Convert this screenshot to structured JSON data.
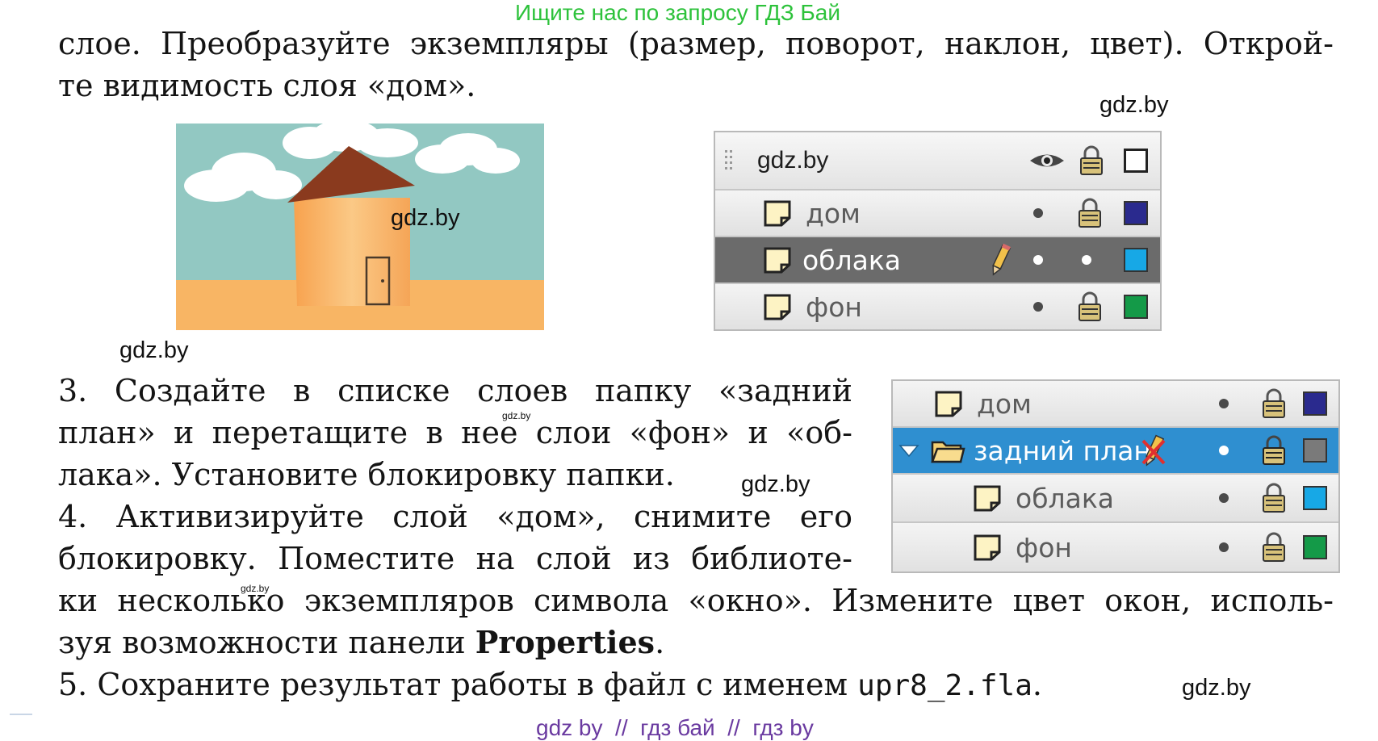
{
  "banner": "Ищите нас по запросу ГДЗ Бай",
  "paragraph_top": {
    "line1": "слое. Преобразуйте экземпляры (размер, поворот, наклон, цвет). Открой-",
    "line2": "те видимость слоя «дом»."
  },
  "step3": {
    "line1": "3. Создайте в списке слоев папку «задний",
    "line2": "план» и перетащите в нее слои «фон» и «об-",
    "line3": "лака». Установите блокировку папки."
  },
  "step4": {
    "line1": "4. Активизируйте слой «дом», снимите его",
    "line2": "блокировку. Поместите на слой из библиоте-",
    "line3": "ки несколько экземпляров символа «окно». Измените цвет окон, исполь-",
    "line4_prefix": "зуя возможности панели ",
    "line4_bold": "Properties",
    "line4_suffix": "."
  },
  "step5": {
    "prefix": "5. Сохраните результат работы в файл с именем ",
    "filename": "upr8_2.fla",
    "suffix": "."
  },
  "watermarks": {
    "large": "gdz.by",
    "small": "gdz.by"
  },
  "footer": "gdz by  //  гдз бай  //  гдз by",
  "panel1": {
    "header": "gdz.by",
    "header_icons": [
      "eye-icon",
      "lock-icon",
      "outline-icon"
    ],
    "rows": [
      {
        "name": "дом",
        "visible": "dot",
        "lock": "locked",
        "color": "#2a2a8e"
      },
      {
        "name": "облака",
        "visible": "dot",
        "lock": "dot",
        "color": "#17a8e6",
        "selected": true,
        "editing": "pencil-icon"
      },
      {
        "name": "фон",
        "visible": "dot",
        "lock": "locked",
        "color": "#149a48"
      }
    ]
  },
  "panel2": {
    "rows": [
      {
        "name": "дом",
        "visible": "dot",
        "lock": "locked",
        "color": "#2a2a8e"
      },
      {
        "name": "задний план",
        "type": "folder",
        "expanded": true,
        "visible": "dot",
        "lock": "locked",
        "color": "#7a7a7a",
        "selected": true,
        "editing": "pencil-crossed-icon"
      },
      {
        "name": "облака",
        "indent": true,
        "visible": "dot",
        "lock": "locked",
        "color": "#17a8e6"
      },
      {
        "name": "фон",
        "indent": true,
        "visible": "dot",
        "lock": "locked",
        "color": "#149a48"
      }
    ]
  }
}
